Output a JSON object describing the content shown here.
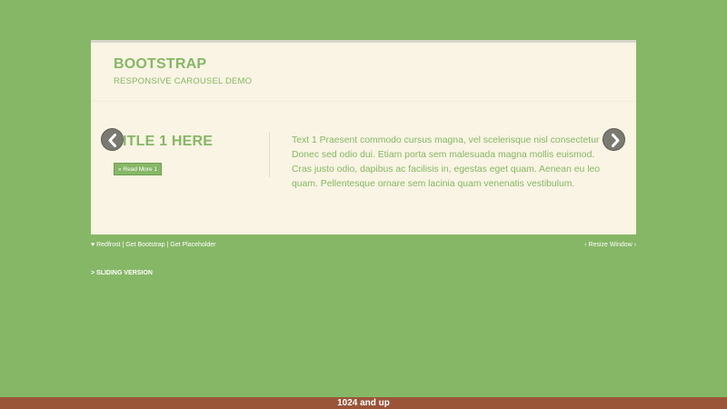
{
  "header": {
    "brand": "BOOTSTRAP",
    "subtitle": "RESPONSIVE CAROUSEL DEMO"
  },
  "slide": {
    "title": "TITLE 1 HERE",
    "read_more": "» Read More 1",
    "text": "Text 1 Praesent commodo cursus magna, vel scelerisque nisl consectetur et. Donec sed odio dui. Etiam porta sem malesuada magna mollis euismod. Cras justo odio, dapibus ac facilisis in, egestas eget quam. Aenean eu leo quam. Pellentesque ornare sem lacinia quam venenatis vestibulum."
  },
  "footer": {
    "heart": "♥",
    "link_redfrost": "Redfrost",
    "link_bootstrap": "Get Bootstrap",
    "link_placeholder": "Get Placeholder",
    "separator": "|",
    "resize": "‹ Resize Window ›",
    "sliding": "> SLIDING VERSION"
  },
  "breakpoint_label": "1024 and up",
  "colors": {
    "background": "#86b766",
    "card": "#f9f4e3",
    "accent": "#86b766",
    "arrow": "#7a7a72",
    "bottom_bar": "#9a5538"
  },
  "icons": {
    "prev": "chevron-left-icon",
    "next": "chevron-right-icon",
    "heart": "heart-icon"
  }
}
